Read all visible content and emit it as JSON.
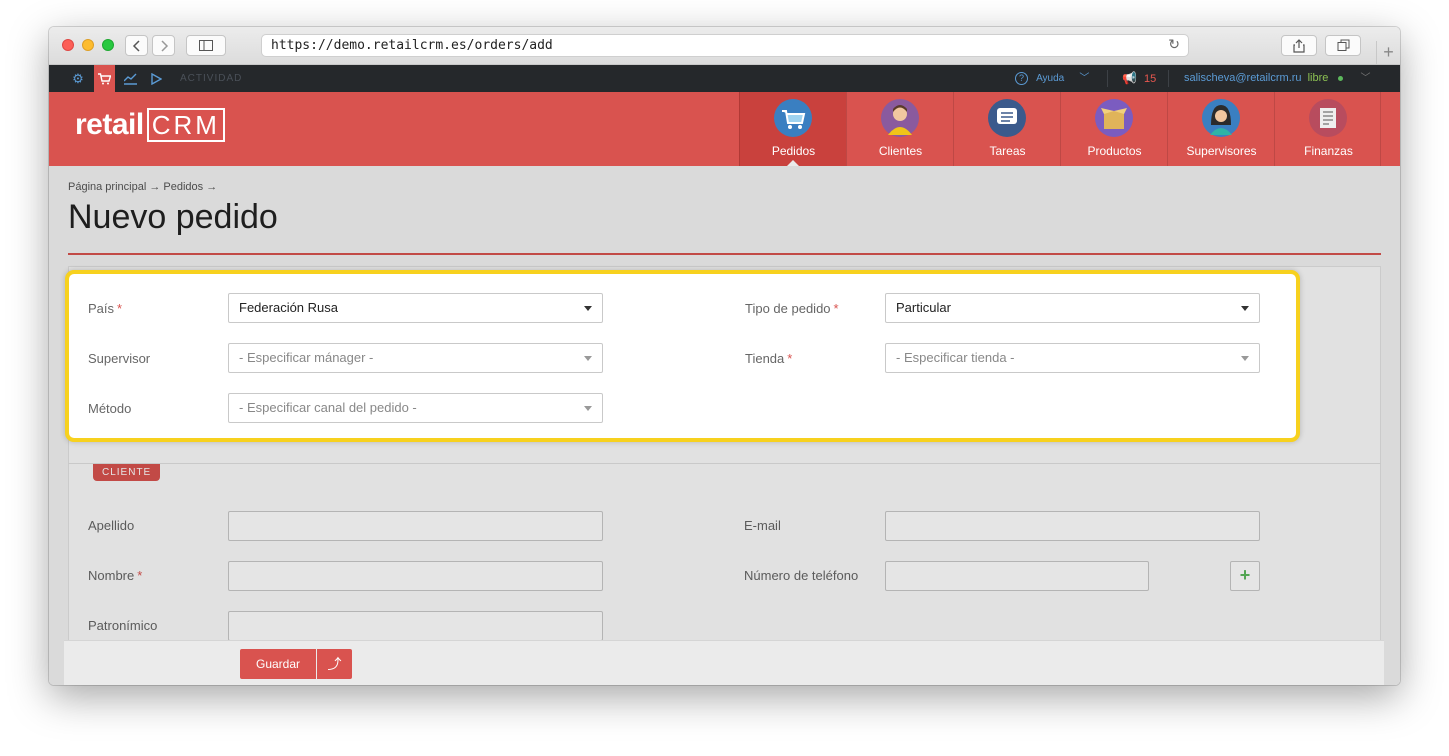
{
  "browser": {
    "url": "https://demo.retailcrm.es/orders/add",
    "back_icon": "chevron-left",
    "forward_icon": "chevron-right",
    "sidebar_icon": "sidebar",
    "reload_icon": "reload",
    "share_icon": "share",
    "tabs_icon": "tabs",
    "newtab_icon": "plus"
  },
  "topbar": {
    "activity_label": "ACTIVIDAD",
    "help_label": "Ayuda",
    "notifications_count": "15",
    "user_email": "salischeva@retailcrm.ru",
    "user_status": "libre"
  },
  "header": {
    "logo_text": "retail",
    "logo_crm": "CRM",
    "nav": [
      {
        "label": "Pedidos",
        "icon": "cart-icon",
        "color": "#3a7fc1"
      },
      {
        "label": "Clientes",
        "icon": "customer-icon",
        "color": "#8a5a9e"
      },
      {
        "label": "Tareas",
        "icon": "tasks-icon",
        "color": "#3b5a8c"
      },
      {
        "label": "Productos",
        "icon": "box-icon",
        "color": "#7b5cc0"
      },
      {
        "label": "Supervisores",
        "icon": "manager-icon",
        "color": "#3a7fc1"
      },
      {
        "label": "Finanzas",
        "icon": "finance-icon",
        "color": "#b84c5e"
      }
    ]
  },
  "page": {
    "breadcrumb": "Página principal → Pedidos →",
    "title": "Nuevo pedido"
  },
  "order_form": {
    "country_label": "País",
    "country_value": "Federación Rusa",
    "supervisor_label": "Supervisor",
    "supervisor_placeholder": "- Especificar mánager -",
    "method_label": "Método",
    "method_placeholder": "- Especificar canal del pedido -",
    "order_type_label": "Tipo de pedido",
    "order_type_value": "Particular",
    "store_label": "Tienda",
    "store_placeholder": "- Especificar tienda -",
    "required_mark": "*"
  },
  "customer_section": {
    "badge": "CLIENTE",
    "lastname_label": "Apellido",
    "firstname_label": "Nombre",
    "patronymic_label": "Patronímico",
    "email_label": "E-mail",
    "phone_label": "Número de teléfono",
    "add_phone": "+"
  },
  "footer": {
    "save_label": "Guardar",
    "save_arrow": "⤴"
  },
  "colors": {
    "brand_red": "#d9534f",
    "highlight": "#f7d11e",
    "topbar_bg": "#25282b"
  }
}
